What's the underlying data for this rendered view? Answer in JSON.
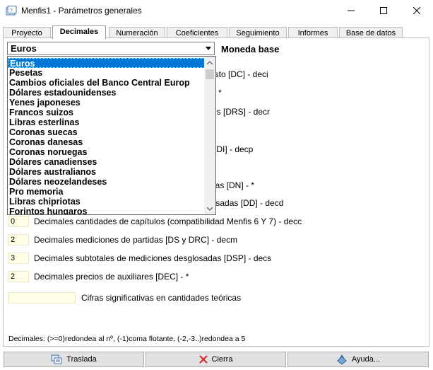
{
  "window": {
    "title": "Menfis1 - Parámetros generales",
    "app_icon": "app-window-icon",
    "controls": {
      "minimize": "minimize-icon",
      "maximize": "maximize-icon",
      "close": "close-icon"
    }
  },
  "tabs": [
    "Proyecto",
    "Decimales",
    "Numeración",
    "Coeficientes",
    "Seguimiento",
    "Informes",
    "Base de datos"
  ],
  "active_tab": "Decimales",
  "currency": {
    "selected": "Euros",
    "label": "Moneda base",
    "options": [
      "Euros",
      "Pesetas",
      "Cambios oficiales del Banco Central Europ",
      "Dólares estadounidenses",
      "Yenes japoneses",
      "Francos suizos",
      "Libras esterlinas",
      "Coronas suecas",
      "Coronas danesas",
      "Coronas noruegas",
      "Dólares canadienses",
      "Dólares australianos",
      "Dólares neozelandeses",
      "Pro memoria",
      "Libras chipriotas",
      "Forintos hungaros"
    ]
  },
  "partial_labels": {
    "r1": "esto [DC] - deci",
    "r2": "*",
    "r3": "sos [DRS] - decr",
    "r4": "[DI] - decp",
    "r5": "das [DN] - *",
    "r6": "losadas [DD] - decd"
  },
  "fields": [
    {
      "value": "0",
      "label": "Decimales cantidades de capítulos (compatibilidad Menfis 6 Y 7) - decc"
    },
    {
      "value": "2",
      "label": "Decimales mediciones de partidas [DS y DRC] - decm"
    },
    {
      "value": "3",
      "label": "Decimales subtotales de mediciones desglosadas [DSP] - decs"
    },
    {
      "value": "2",
      "label": "Decimales precios de auxiliares [DEC] - *"
    }
  ],
  "significant": {
    "value": "",
    "label": "Cifras significativas en cantidades teóricas"
  },
  "footnote": "Decimales: (>=0)redondea al nº, (-1)coma flotante, (-2,-3..)redondea a 5",
  "buttons": {
    "traslada": "Traslada",
    "cierra": "Cierra",
    "ayuda": "Ayuda..."
  }
}
